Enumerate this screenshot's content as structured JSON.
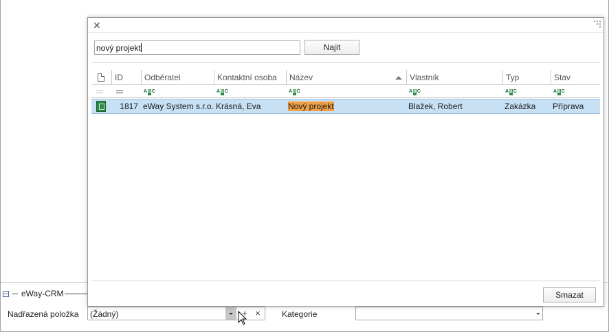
{
  "background": {
    "group_title": "eWay-CRM",
    "parent_label": "Nadřazená položka",
    "parent_value": "(Žádný)",
    "category_label": "Kategorie",
    "category_value": ""
  },
  "dialog": {
    "search_value": "nový projekt",
    "find_button": "Najít",
    "clear_button": "Smazat",
    "columns": [
      {
        "key": "icon",
        "label": ""
      },
      {
        "key": "id",
        "label": "ID"
      },
      {
        "key": "customer",
        "label": "Odběratel"
      },
      {
        "key": "contact",
        "label": "Kontaktní osoba"
      },
      {
        "key": "name",
        "label": "Název",
        "sorted": "ascending"
      },
      {
        "key": "owner",
        "label": "Vlastník"
      },
      {
        "key": "type",
        "label": "Typ"
      },
      {
        "key": "state",
        "label": "Stav"
      }
    ],
    "filter_icon_text": "ABC",
    "rows": [
      {
        "icon": "project-icon",
        "id": "1817",
        "customer": "eWay System s.r.o.",
        "contact": "Krásná, Eva",
        "name": "Nový projekt",
        "owner": "Blažek, Robert",
        "type": "Zakázka",
        "state": "Příprava",
        "selected": true
      }
    ]
  },
  "colors": {
    "selection": "#c8e0f4",
    "highlight": "#f0a046",
    "project_icon": "#2f8a48"
  }
}
